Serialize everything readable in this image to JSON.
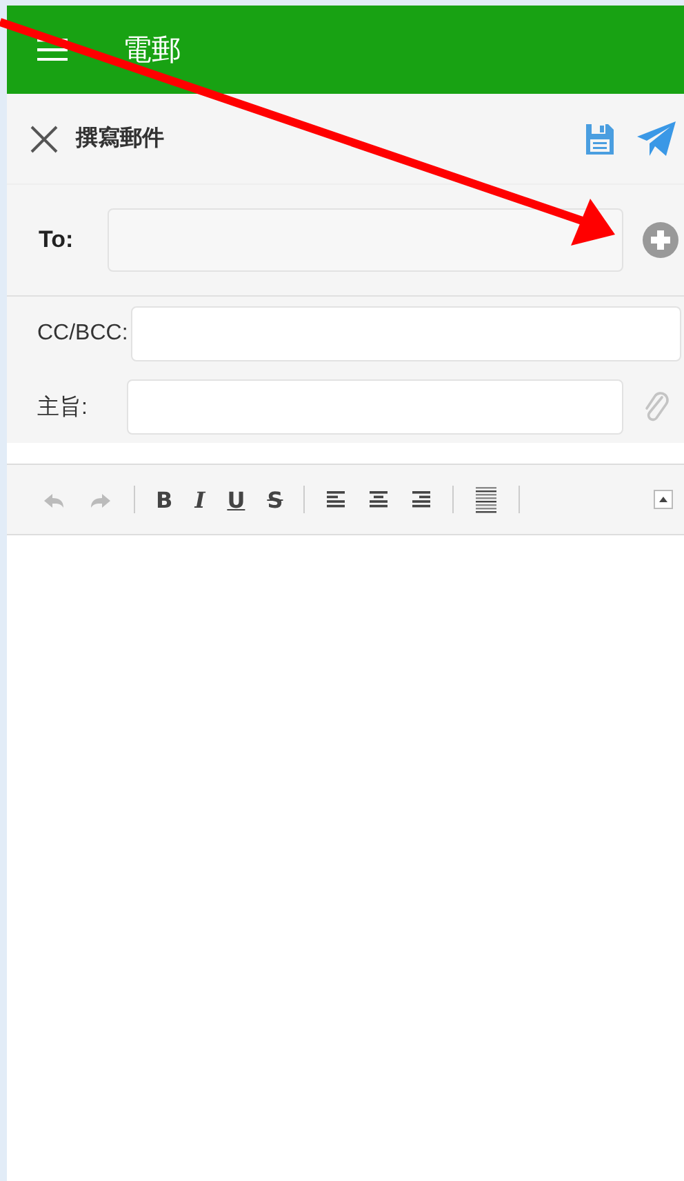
{
  "app_bar": {
    "title": "電郵"
  },
  "compose_bar": {
    "title": "撰寫郵件"
  },
  "fields": [
    {
      "kind": "to",
      "label": "To:"
    },
    {
      "kind": "cc",
      "label": "CC/BCC:"
    },
    {
      "kind": "subject",
      "label": "主旨:"
    }
  ],
  "editor_toolbar": [
    {
      "kind": "undo",
      "disabled": true
    },
    {
      "kind": "redo",
      "disabled": true
    },
    {
      "kind": "separator"
    },
    {
      "kind": "bold",
      "label": "B"
    },
    {
      "kind": "italic",
      "label": "I"
    },
    {
      "kind": "underline",
      "label": "U"
    },
    {
      "kind": "strike",
      "label": "S"
    },
    {
      "kind": "separator"
    },
    {
      "kind": "align_left"
    },
    {
      "kind": "align_center"
    },
    {
      "kind": "align_right"
    },
    {
      "kind": "separator"
    },
    {
      "kind": "justify"
    },
    {
      "kind": "separator"
    }
  ],
  "annotation": {
    "kind": "arrow"
  }
}
